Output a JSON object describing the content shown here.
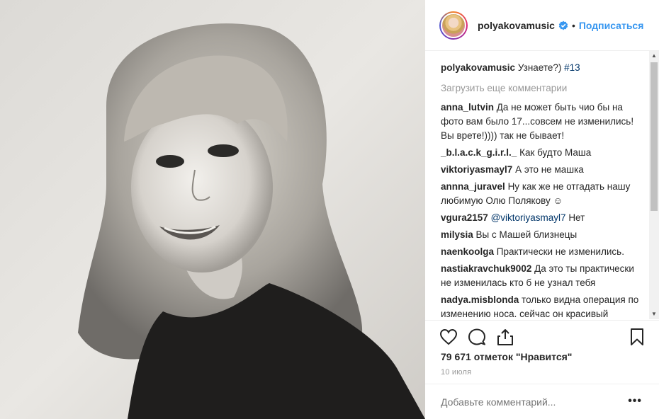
{
  "header": {
    "username": "polyakovamusic",
    "separator": "•",
    "follow_label": "Подписаться"
  },
  "caption": {
    "username": "polyakovamusic",
    "text": "Узнаете?)",
    "hashtag": "#13"
  },
  "load_more_label": "Загрузить еще комментарии",
  "comments": [
    {
      "user": "anna_lutvin",
      "text": "Да не может быть чио бы на фото вам было 17...совсем не изменились! Вы врете!)))) так не бывает!"
    },
    {
      "user": "_b.l.a.c.k_g.i.r.l._",
      "text": "Как будто Маша"
    },
    {
      "user": "viktoriyasmayl7",
      "text": "А это не машка"
    },
    {
      "user": "annna_juravel",
      "text": "Ну как же не отгадать нашу любимую Олю Полякову ☺"
    },
    {
      "user": "vgura2157",
      "mention": "@viktoriyasmayl7",
      "text": "Нет"
    },
    {
      "user": "milysia",
      "text": "Вы с Машей близнецы"
    },
    {
      "user": "naenkoolga",
      "text": "Практически не изменились."
    },
    {
      "user": "nastiakravchuk9002",
      "text": "Да это ты практически не изменилась кто б не узнал тебя"
    },
    {
      "user": "nadya.misblonda",
      "text": "только видна операция по изменению носа. сейчас он красивый"
    }
  ],
  "likes_label": "79 671 отметок \"Нравится\"",
  "date_label": "10 июля",
  "add_comment_placeholder": "Добавьте комментарий...",
  "more_label": "•••",
  "icons": {
    "like": "heart-icon",
    "comment": "comment-icon",
    "share": "share-icon",
    "save": "bookmark-icon",
    "verified": "verified-badge-icon"
  },
  "colors": {
    "link_blue": "#3897f0",
    "mention_blue": "#003569",
    "muted": "#999999",
    "text": "#262626"
  }
}
